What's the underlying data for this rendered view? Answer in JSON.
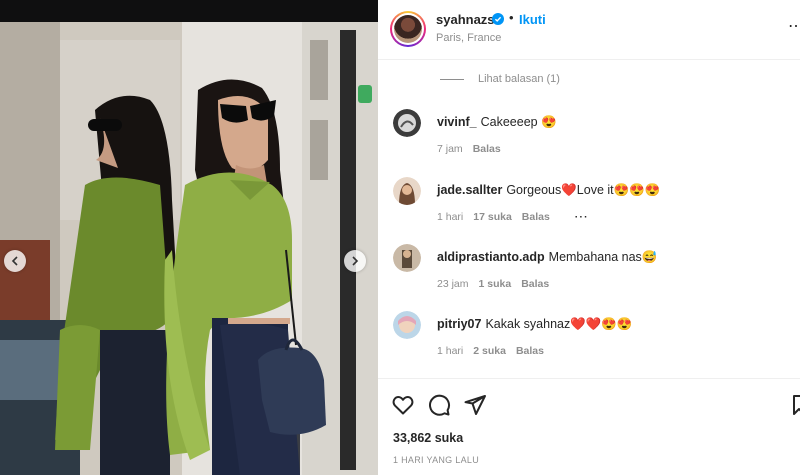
{
  "post": {
    "username": "syahnazs",
    "separator": "•",
    "follow_label": "Ikuti",
    "location": "Paris, France",
    "verified_icon": "verified-badge-icon",
    "accent_color": "#0095f6"
  },
  "thread": {
    "view_replies_label": "Lihat balasan (1)"
  },
  "comments": [
    {
      "username": "vivinf_",
      "text": "Cakeeeep 😍",
      "time": "7 jam",
      "likes": "",
      "reply": "Balas"
    },
    {
      "username": "jade.sallter",
      "text": "Gorgeous❤️Love it😍😍😍",
      "time": "1 hari",
      "likes": "17 suka",
      "reply": "Balas"
    },
    {
      "username": "aldiprastianto.adp",
      "text": "Membahana nas😅",
      "time": "23 jam",
      "likes": "1 suka",
      "reply": "Balas"
    },
    {
      "username": "pitriy07",
      "text": "Kakak syahnaz❤️❤️😍😍",
      "time": "1 hari",
      "likes": "2 suka",
      "reply": "Balas"
    }
  ],
  "actions": {
    "like_icon": "heart-icon",
    "comment_icon": "comment-icon",
    "share_icon": "send-icon",
    "save_icon": "bookmark-icon"
  },
  "likes_count": "33,862 suka",
  "posted_time": "1 HARI YANG LALU",
  "more_options": "⋯"
}
